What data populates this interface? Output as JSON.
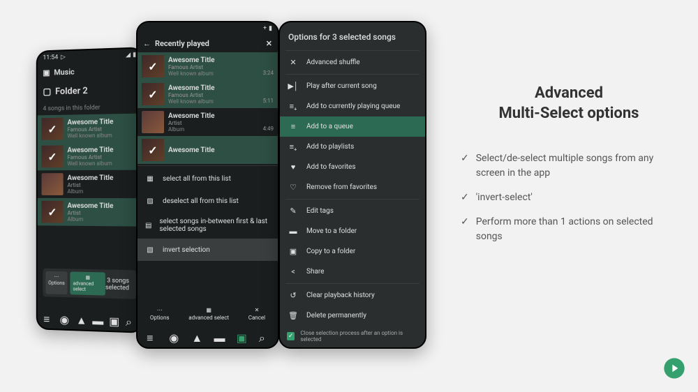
{
  "colors": {
    "accent": "#2d6a53",
    "dark": "#1a1e1e",
    "panel": "#2a2e2e"
  },
  "status": {
    "time": "11:54",
    "icons": [
      "play"
    ]
  },
  "phoneBack": {
    "header": {
      "folder_icon": "folder",
      "label": "Music"
    },
    "folder": {
      "icon": "folder-outline",
      "label": "Folder 2"
    },
    "sub": "4 songs in this folder",
    "songs": [
      {
        "title": "Awesome Title",
        "artist": "Famous Artist",
        "album": "Well known album",
        "selected": true
      },
      {
        "title": "Awesome Title",
        "artist": "Famous Artist",
        "album": "Well known album",
        "selected": true
      },
      {
        "title": "Awesome Title",
        "artist": "Artist",
        "album": "Album",
        "selected": false
      },
      {
        "title": "Awesome Title",
        "artist": "Artist",
        "album": "Album",
        "selected": true
      }
    ],
    "toast": {
      "count": "3 songs selected",
      "options_label": "Options",
      "adv_label": "advanced select"
    }
  },
  "phoneMid": {
    "header": {
      "title": "Recently played"
    },
    "songs": [
      {
        "title": "Awesome Title",
        "artist": "Famous Artist",
        "album": "Well known album",
        "dur": "3:24",
        "selected": true
      },
      {
        "title": "Awesome Title",
        "artist": "Famous Artist",
        "album": "Well known album",
        "dur": "5:11",
        "selected": true
      },
      {
        "title": "Awesome Title",
        "artist": "Artist",
        "album": "Album",
        "dur": "4:49",
        "selected": false
      },
      {
        "title": "Awesome Title",
        "artist": "",
        "album": "",
        "dur": "",
        "selected": true
      }
    ],
    "selectOptions": [
      {
        "label": "select all from this list",
        "icon": "select-all"
      },
      {
        "label": "deselect all from this list",
        "icon": "deselect-all"
      },
      {
        "label": "select songs in-between first & last selected songs",
        "icon": "inbetween"
      },
      {
        "label": "invert selection",
        "icon": "invert",
        "highlighted": true
      }
    ],
    "bottom": {
      "options": "Options",
      "adv": "advanced select",
      "cancel": "Cancel"
    }
  },
  "phoneFront": {
    "title": "Options for 3 selected songs",
    "items": [
      {
        "label": "Advanced shuffle",
        "icon": "shuffle"
      },
      {
        "divider": true
      },
      {
        "label": "Play after current song",
        "icon": "skip-next"
      },
      {
        "label": "Add to currently playing queue",
        "icon": "queue-add"
      },
      {
        "label": "Add to a queue",
        "icon": "queue",
        "highlighted": true
      },
      {
        "label": "Add to playlists",
        "icon": "playlist-add"
      },
      {
        "label": "Add to favorites",
        "icon": "heart"
      },
      {
        "label": "Remove from favorites",
        "icon": "heart-outline"
      },
      {
        "divider": true
      },
      {
        "label": "Edit tags",
        "icon": "pencil"
      },
      {
        "label": "Move to a folder",
        "icon": "folder-move"
      },
      {
        "label": "Copy to a folder",
        "icon": "folder-copy"
      },
      {
        "label": "Share",
        "icon": "share"
      },
      {
        "divider": true
      },
      {
        "label": "Clear playback history",
        "icon": "history-clear"
      },
      {
        "label": "Delete permanently",
        "icon": "trash"
      }
    ],
    "close_check": "Close selection process after an option is selected"
  },
  "promo": {
    "title_line1": "Advanced",
    "title_line2": "Multi-Select options",
    "bullets": [
      "Select/de-select multiple songs from any screen in the app",
      "'invert-select'",
      "Perform more than 1 actions on selected songs"
    ]
  }
}
